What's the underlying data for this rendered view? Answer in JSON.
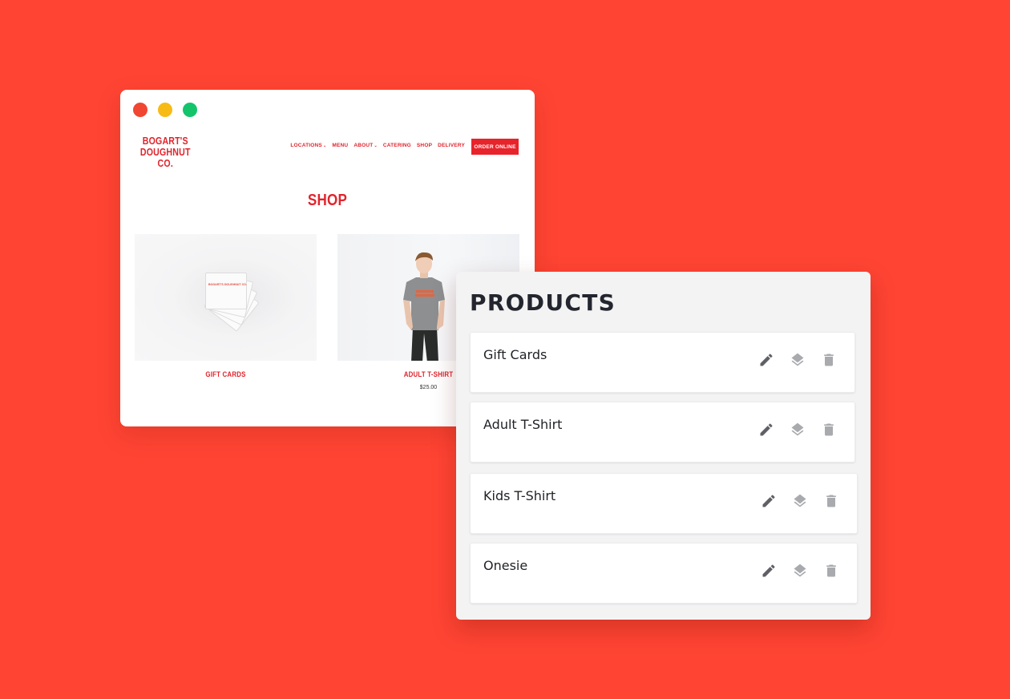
{
  "background_color": "#ff4433",
  "website": {
    "window_controls": [
      "close",
      "minimize",
      "maximize"
    ],
    "logo": [
      "BOGART'S",
      "DOUGHNUT CO."
    ],
    "nav": [
      {
        "label": "LOCATIONS",
        "has_dropdown": true
      },
      {
        "label": "MENU",
        "has_dropdown": false
      },
      {
        "label": "ABOUT",
        "has_dropdown": true
      },
      {
        "label": "CATERING",
        "has_dropdown": false
      },
      {
        "label": "SHOP",
        "has_dropdown": false
      },
      {
        "label": "DELIVERY",
        "has_dropdown": false
      }
    ],
    "dropdown_glyph": "⌄",
    "order_button": "ORDER ONLINE",
    "page_title": "SHOP",
    "products": [
      {
        "name": "GIFT CARDS",
        "price": "",
        "image": "gift-cards-photo",
        "card_text": "BOGART'S DOUGHNUT CO."
      },
      {
        "name": "ADULT T-SHIRT",
        "price": "$25.00",
        "image": "person-in-tshirt-photo"
      }
    ],
    "brand_color": "#e0242c"
  },
  "products_panel": {
    "title": "PRODUCTS",
    "items": [
      {
        "name": "Gift Cards"
      },
      {
        "name": "Adult T-Shirt"
      },
      {
        "name": "Kids T-Shirt"
      },
      {
        "name": "Onesie"
      }
    ],
    "actions": [
      {
        "icon": "pencil-icon",
        "label": "edit",
        "color": "#5f6066"
      },
      {
        "icon": "layers-icon",
        "label": "variants",
        "color": "#a9aaae"
      },
      {
        "icon": "trash-icon",
        "label": "delete",
        "color": "#a9aaae"
      }
    ]
  }
}
